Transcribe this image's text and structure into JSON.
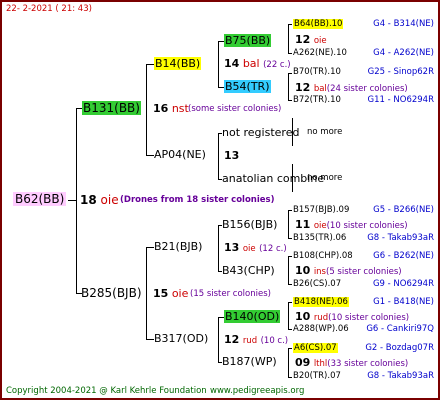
{
  "header": {
    "date": "22-  2-2021  ( 21:  43)"
  },
  "footer": {
    "copyright": "Copyright 2004-2021 @ Karl Kehrle Foundation",
    "site": "www.pedigreeapis.org"
  },
  "root": {
    "id": "B62(BB)",
    "year": "18",
    "origin": "oie",
    "note": "(Drones from 18 sister colonies)"
  },
  "gen2": [
    {
      "id": "B131(BB)",
      "year": "16",
      "origin": "nst",
      "note": "(some sister colonies)"
    },
    {
      "id": "B285(BJB)",
      "year": "15",
      "origin": "oie",
      "note": "(15 sister colonies)"
    }
  ],
  "gen3": [
    {
      "id": "B14(BB)",
      "year": "14",
      "origin": "bal",
      "note": "(22 c.)"
    },
    {
      "id": "AP04(NE)",
      "year": "13",
      "origin": "",
      "note": ""
    },
    {
      "id": "B21(BJB)",
      "year": "13",
      "origin": "oie",
      "note": "(12 c.)"
    },
    {
      "id": "B317(OD)",
      "year": "12",
      "origin": "rud",
      "note": "(10 c.)"
    }
  ],
  "gen4": [
    {
      "id": "B75(BB)"
    },
    {
      "id": "B54(TR)"
    },
    {
      "id": "not registered"
    },
    {
      "id": "anatolian combine"
    },
    {
      "id": "B156(BJB)"
    },
    {
      "id": "B43(CHP)"
    },
    {
      "id": "B140(OD)"
    },
    {
      "id": "B187(WP)"
    }
  ],
  "gen5": [
    {
      "top": "B64(BB).10",
      "topRef": "G4 - B314(NE)",
      "mid": "12",
      "midOrigin": "oie",
      "midNote": "",
      "bot": "A262(NE).10",
      "botRef": "G4 - A262(NE)"
    },
    {
      "top": "B70(TR).10",
      "topRef": "G25 - Sinop62R",
      "mid": "12",
      "midOrigin": "bal",
      "midNote": "(24 sister colonies)",
      "bot": "B72(TR).10",
      "botRef": "G11 - NO6294R"
    },
    {
      "top": "",
      "topRef": "no more",
      "mid": "",
      "midOrigin": "",
      "midNote": "",
      "bot": "",
      "botRef": ""
    },
    {
      "top": "",
      "topRef": "no more",
      "mid": "",
      "midOrigin": "",
      "midNote": "",
      "bot": "",
      "botRef": ""
    },
    {
      "top": "B157(BJB).09",
      "topRef": "G5 - B266(NE)",
      "mid": "11",
      "midOrigin": "oie",
      "midNote": "(10 sister colonies)",
      "bot": "B135(TR).06",
      "botRef": "G8 - Takab93aR"
    },
    {
      "top": "B108(CHP).08",
      "topRef": "G6 - B262(NE)",
      "mid": "10",
      "midOrigin": "ins",
      "midNote": "(5 sister colonies)",
      "bot": "B26(CS).07",
      "botRef": "G9 - NO6294R"
    },
    {
      "top": "B418(NE).06",
      "topRef": "G1 - B418(NE)",
      "mid": "10",
      "midOrigin": "rud",
      "midNote": "(10 sister colonies)",
      "bot": "A288(WP).06",
      "botRef": "G6 - Cankiri97Q"
    },
    {
      "top": "A6(CS).07",
      "topRef": "G2 - Bozdag07R",
      "mid": "09",
      "midOrigin": "lthl",
      "midNote": "(33 sister colonies)",
      "bot": "B20(TR).07",
      "botRef": "G8 - Takab93aR"
    }
  ]
}
